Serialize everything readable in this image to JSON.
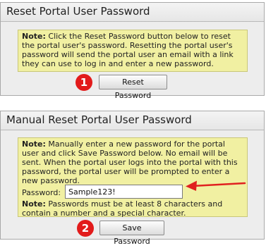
{
  "reset_panel": {
    "title": "Reset Portal User Password",
    "note_label": "Note:",
    "note_text": " Click the Reset Password button below to reset the portal user's password. Resetting the portal user's password will send the portal user an email with a link they can use to log in and enter a new password.",
    "badge": "1",
    "button_label": "Reset Password"
  },
  "manual_panel": {
    "title": "Manual Reset Portal User Password",
    "note_label": "Note:",
    "note_text": " Manually enter a new password for the portal user and click Save Password below. No email will be sent. When the portal user logs into the portal with this password, the portal user will be prompted to enter a new password.",
    "password_label": "Password:",
    "password_value": "Sample123!",
    "note2_label": "Note:",
    "note2_text": " Passwords must be at least 8 characters and contain a number and a special character.",
    "badge": "2",
    "button_label": "Save Password"
  },
  "colors": {
    "note_bg": "#f1f0a2",
    "badge": "#e21b1b",
    "arrow": "#e02020"
  }
}
